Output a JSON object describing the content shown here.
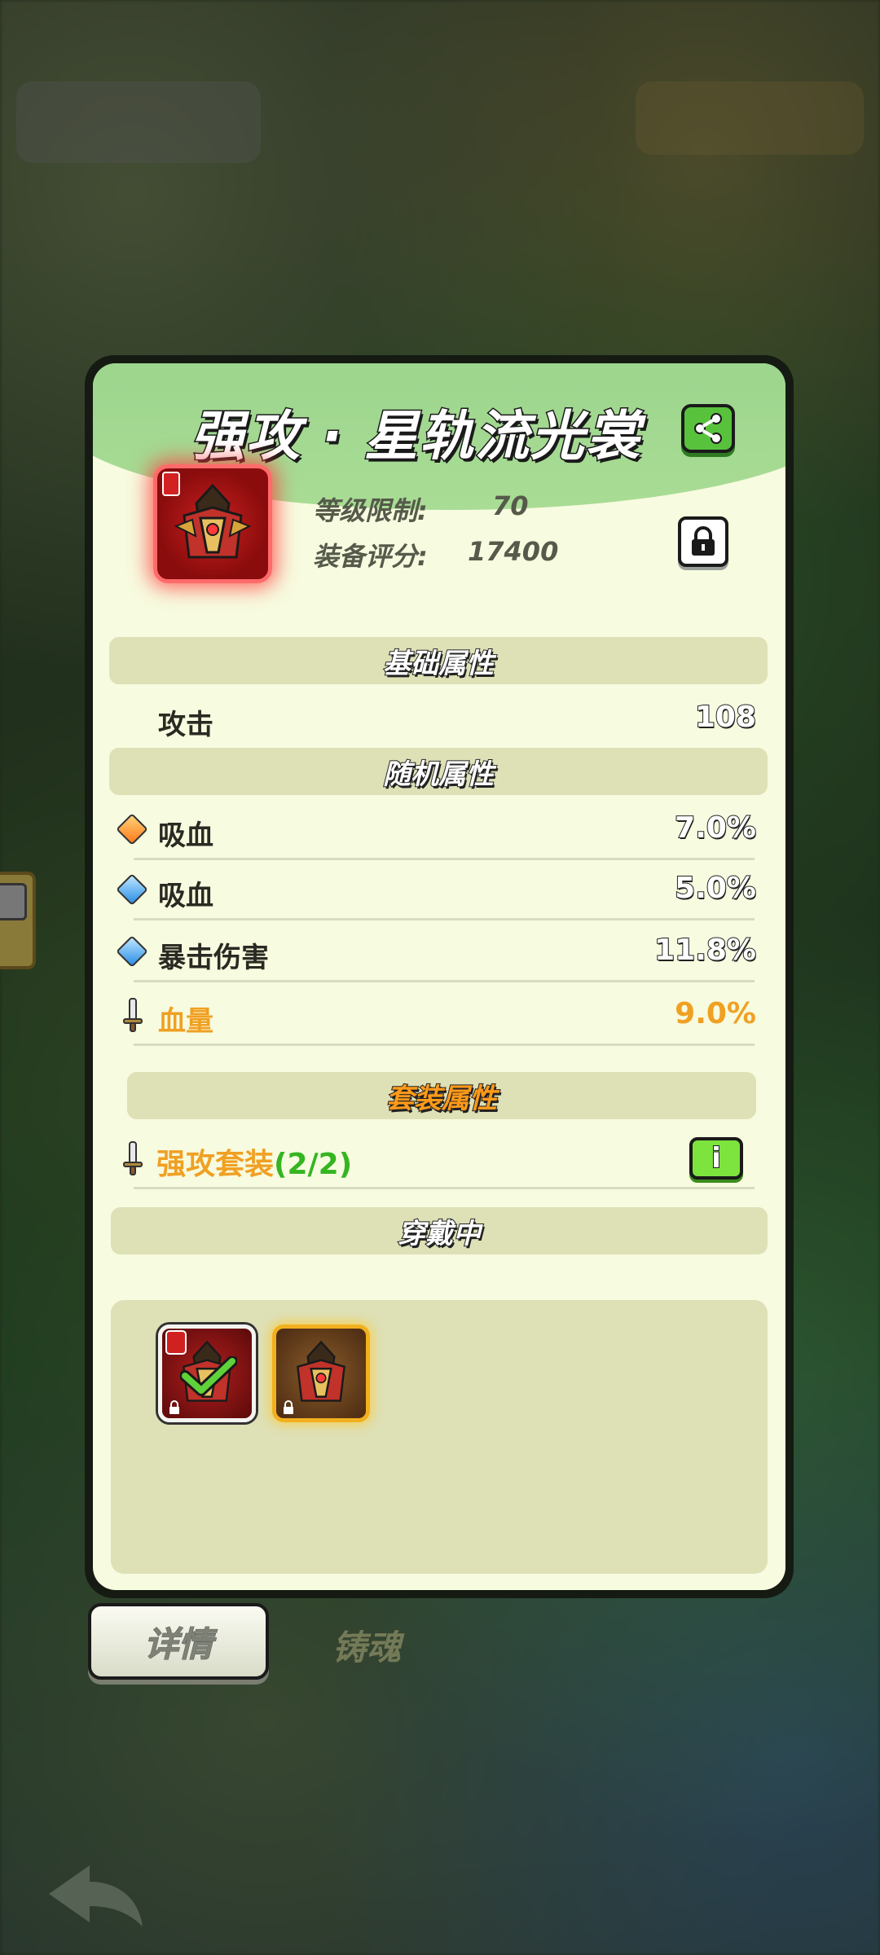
{
  "item": {
    "title": "强攻 · 星轨流光裳",
    "level_label": "等级限制:",
    "level_value": "70",
    "score_label": "装备评分:",
    "score_value": "17400"
  },
  "sections": {
    "base": "基础属性",
    "random": "随机属性",
    "set": "套装属性",
    "equipped": "穿戴中"
  },
  "base_attrs": [
    {
      "name": "攻击",
      "value": "108"
    }
  ],
  "random_attrs": [
    {
      "gem": "orange",
      "name": "吸血",
      "value": "7.0%"
    },
    {
      "gem": "blue",
      "name": "吸血",
      "value": "5.0%"
    },
    {
      "gem": "blue",
      "name": "暴击伤害",
      "value": "11.8%"
    },
    {
      "gem": "sword",
      "name": "血量",
      "value": "9.0%"
    }
  ],
  "set_attr": {
    "name": "强攻套装",
    "count": "(2/2)",
    "info_label": "i"
  },
  "tabs": {
    "details": "详情",
    "forge_soul": "铸魂"
  },
  "colors": {
    "accent_green": "#58c23c",
    "orange_text": "#f0a023",
    "panel_bg": "#f7fbdf",
    "section_bg": "#dee0b6"
  },
  "icons": {
    "share": "share-icon",
    "lock": "lock-icon",
    "info": "info-icon",
    "check": "check-icon",
    "sword": "sword-icon"
  }
}
